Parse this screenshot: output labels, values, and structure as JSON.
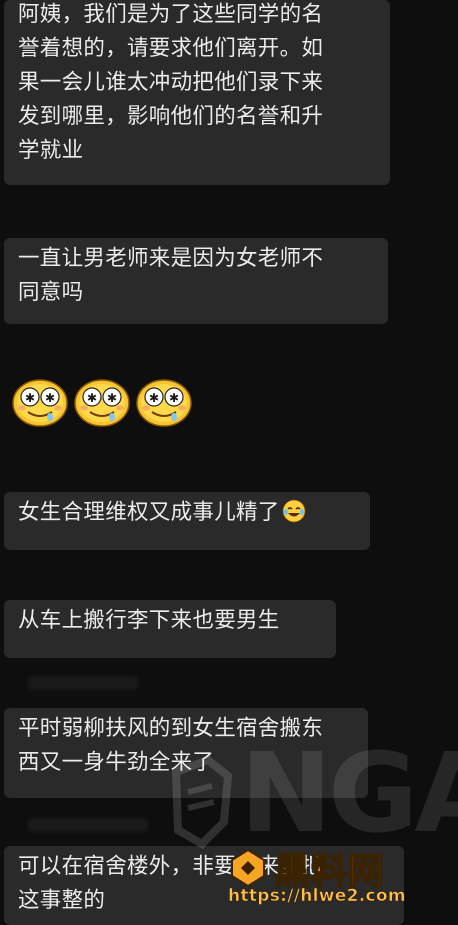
{
  "messages": [
    {
      "text": "阿姨，我们是为了这些同学的名誉着想的，请要求他们离开。如果一会儿谁太冲动把他们录下来发到哪里，影响他们的名誉和升学就业"
    },
    {
      "text": "一直让男老师来是因为女老师不同意吗"
    },
    {
      "emoji": "drooling-star-eyes-face",
      "count": 3
    },
    {
      "text": "女生合理维权又成事儿精了",
      "trailing_emoji": "tears-of-joy-face"
    },
    {
      "text": "从车上搬行李下来也要男生"
    },
    {
      "text": "平时弱柳扶风的到女生宿舍搬东西又一身牛劲全来了"
    },
    {
      "text": "可以在宿舍楼外，非要进来，把这事整的"
    }
  ],
  "watermarks": {
    "forum": "NGA",
    "site_name": "黑料网",
    "site_url": "https://hlwe2.com"
  },
  "colors": {
    "background": "#0e0e0e",
    "bubble": "#2a2a2a",
    "text": "#ececec",
    "logo_accent": "#f5a623"
  }
}
